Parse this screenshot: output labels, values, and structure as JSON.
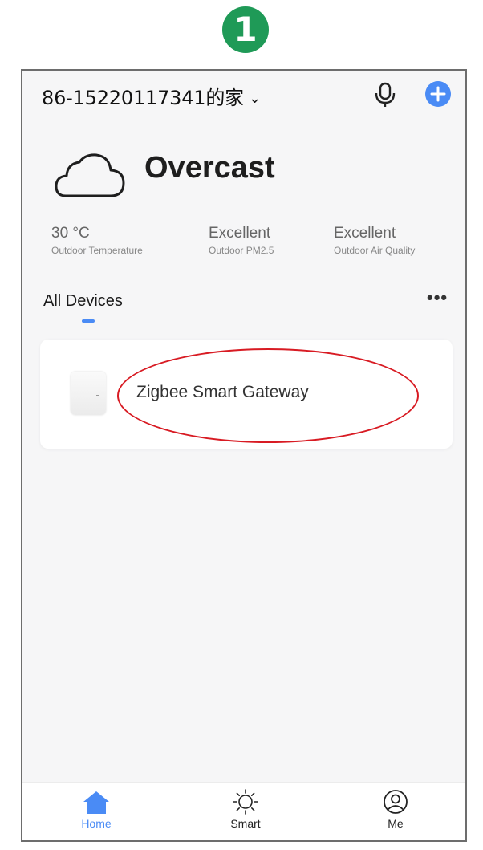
{
  "step_number": "1",
  "header": {
    "home_name": "86-15220117341的家",
    "chevron": "⌄"
  },
  "icons": {
    "mic": "microphone-icon",
    "add": "add-plus-icon",
    "weather": "cloud-icon",
    "more": "more-dots-icon"
  },
  "weather": {
    "condition": "Overcast",
    "metrics": [
      {
        "value": "30 °C",
        "label": "Outdoor Temperature"
      },
      {
        "value": "Excellent",
        "label": "Outdoor PM2.5"
      },
      {
        "value": "Excellent",
        "label": "Outdoor Air Quality"
      }
    ]
  },
  "devices_tab": {
    "label": "All Devices",
    "more": "•••"
  },
  "devices": [
    {
      "name": "Zigbee Smart Gateway"
    }
  ],
  "tab_bar": [
    {
      "label": "Home",
      "active": true
    },
    {
      "label": "Smart",
      "active": false
    },
    {
      "label": "Me",
      "active": false
    }
  ],
  "colors": {
    "accent": "#4a8bf5",
    "step_badge": "#1f9a57",
    "highlight": "#d81b23"
  }
}
